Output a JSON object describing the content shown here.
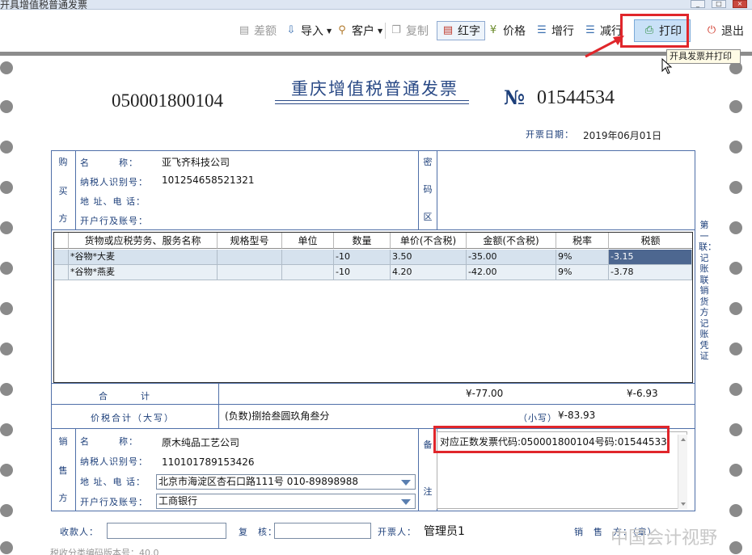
{
  "window": {
    "title": "开具增值税普通发票"
  },
  "toolbar": {
    "items": [
      {
        "label": "差额",
        "icon": "diff-icon",
        "enabled": false
      },
      {
        "label": "导入",
        "icon": "import-icon",
        "enabled": true
      },
      {
        "label": "客户",
        "icon": "customer-icon",
        "enabled": true
      },
      {
        "label": "复制",
        "icon": "copy-icon",
        "enabled": false
      },
      {
        "label": "红字",
        "icon": "red-invoice-icon",
        "enabled": true
      },
      {
        "label": "价格",
        "icon": "price-icon",
        "enabled": true
      },
      {
        "label": "增行",
        "icon": "add-row-icon",
        "enabled": true
      },
      {
        "label": "减行",
        "icon": "remove-row-icon",
        "enabled": true
      },
      {
        "label": "打印",
        "icon": "printer-icon",
        "enabled": true
      },
      {
        "label": "退出",
        "icon": "power-icon",
        "enabled": true
      }
    ],
    "tooltip": "开具发票并打印"
  },
  "invoice": {
    "title": "重庆增值税普通发票",
    "code": "050001800104",
    "no_sign": "№",
    "number": "01544534",
    "date_label": "开票日期：",
    "date": "2019年06月01日",
    "buyer": {
      "section_label": [
        "购",
        "买",
        "方"
      ],
      "name_label": "名　　　称：",
      "name": "亚飞齐科技公司",
      "tax_id_label": "纳税人识别号：",
      "tax_id": "101254658521321",
      "address_label": "地 址、电 话：",
      "address": "",
      "bank_label": "开户行及账号：",
      "bank": ""
    },
    "cipher_label": [
      "密",
      "码",
      "区"
    ],
    "items_header": [
      "货物或应税劳务、服务名称",
      "规格型号",
      "单位",
      "数量",
      "单价(不含税)",
      "金额(不含税)",
      "税率",
      "税额"
    ],
    "items": [
      {
        "name": "*谷物*大麦",
        "spec": "",
        "unit": "",
        "qty": "-10",
        "price": "3.50",
        "amount": "-35.00",
        "rate": "9%",
        "tax": "-3.15"
      },
      {
        "name": "*谷物*燕麦",
        "spec": "",
        "unit": "",
        "qty": "-10",
        "price": "4.20",
        "amount": "-42.00",
        "rate": "9%",
        "tax": "-3.78"
      }
    ],
    "total_label": "合　　　计",
    "total_amount": "¥-77.00",
    "total_tax": "¥-6.93",
    "grand_label": "价税合计（大写）",
    "grand_words": "(负数)捌拾叁圆玖角叁分",
    "grand_small_label": "（小写）",
    "grand_small": "¥-83.93",
    "seller": {
      "section_label": [
        "销",
        "售",
        "方"
      ],
      "name_label": "名　　　称：",
      "name": "原木纯品工艺公司",
      "tax_id_label": "纳税人识别号：",
      "tax_id": "110101789153426",
      "address_label": "地 址、电 话：",
      "address": "北京市海淀区杏石口路111号 010-89898988",
      "bank_label": "开户行及账号：",
      "bank": "工商银行"
    },
    "remark_label": [
      "备",
      "注"
    ],
    "remark": "对应正数发票代码:050001800104号码:01544533",
    "payee_label": "收款人：",
    "reviewer_label": "复　核：",
    "drawer_label": "开票人：",
    "drawer": "管理员1",
    "seller_seal_label": "销　售　方：（章）",
    "side_note": "第一联：记账联　销货方记账凭证",
    "watermark": "中国会计视野",
    "bottom_text": "税收分类编码版本号：40.0"
  },
  "colors": {
    "frame": "#4f6fa8",
    "label": "#1d3f7a",
    "highlight": "#e0262b",
    "selected_cell": "#4d6790"
  }
}
